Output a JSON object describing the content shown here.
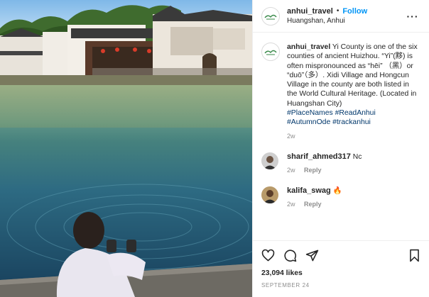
{
  "post": {
    "username": "anhui_travel",
    "separator": "•",
    "follow_label": "Follow",
    "location": "Huangshan, Anhui",
    "more_label": "···"
  },
  "caption": {
    "username": "anhui_travel",
    "text": "Yi County is one of the six counties of ancient Huizhou. “Yi”(黟) is often mispronounced as “hēi” （黑）or “duō”（多）. Xidi Village and Hongcun Village in the county are both listed in the World Cultural Heritage. (Located in Huangshan City)",
    "hashtags": [
      "#PlaceNames",
      "#ReadAnhui",
      "#AutumnOde",
      "#trackanhui"
    ],
    "age": "2w"
  },
  "comments": [
    {
      "username": "sharif_ahmed317",
      "text": "Nc",
      "age": "2w",
      "reply_label": "Reply"
    },
    {
      "username": "kalifa_swag",
      "text": "🔥",
      "age": "2w",
      "reply_label": "Reply"
    }
  ],
  "stats": {
    "likes": "23,094 likes",
    "date": "SEPTEMBER 24"
  },
  "icons": {
    "like": "heart-icon",
    "comment": "comment-icon",
    "share": "send-icon",
    "save": "bookmark-icon"
  },
  "colors": {
    "link": "#0095f6",
    "hashtag": "#00376b",
    "muted": "#8e8e8e",
    "water": "#2f6f7a",
    "sky": "#8fc4ec"
  }
}
